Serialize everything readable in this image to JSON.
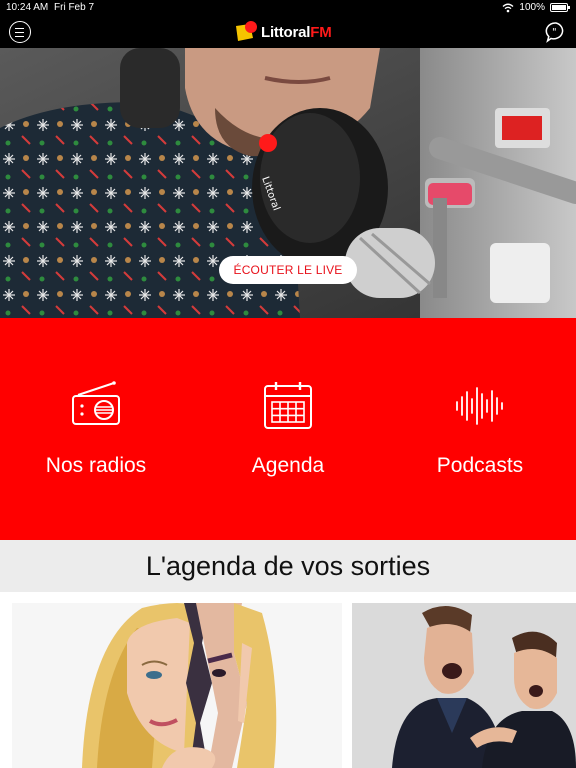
{
  "status_bar": {
    "time": "10:24 AM",
    "date": "Fri Feb 7",
    "battery": "100%"
  },
  "header": {
    "brand_name": "Littoral",
    "brand_suffix": "FM",
    "menu_icon": "hamburger-menu-icon",
    "chat_icon": "chat-bubble-icon"
  },
  "hero": {
    "live_button_label": "ÉCOUTER LE LIVE",
    "image": "radio-host-with-microphone"
  },
  "quick_nav": {
    "background": "#ff0000",
    "items": [
      {
        "label": "Nos radios",
        "icon": "radio-icon"
      },
      {
        "label": "Agenda",
        "icon": "calendar-icon"
      },
      {
        "label": "Podcasts",
        "icon": "soundwave-icon"
      }
    ]
  },
  "agenda": {
    "title": "L'agenda de vos sorties",
    "cards": [
      {
        "image": "event-poster-torn-faces"
      },
      {
        "image": "event-poster-comedians"
      }
    ]
  },
  "colors": {
    "accent": "#ff0000",
    "live_text": "#e8101a",
    "topbar": "#000000",
    "section_header_bg": "#ececec"
  }
}
